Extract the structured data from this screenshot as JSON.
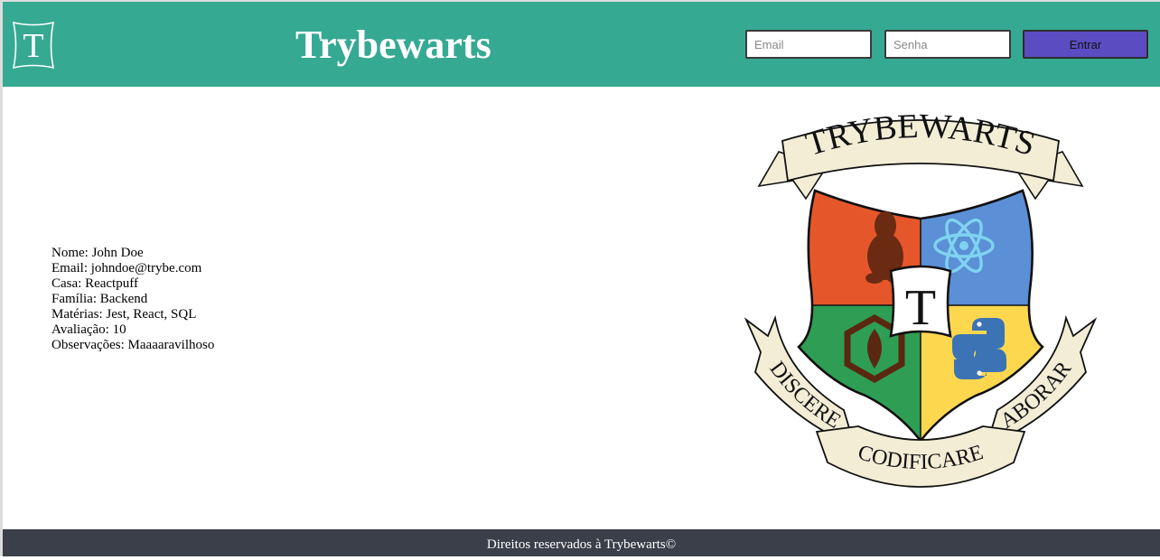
{
  "header": {
    "logo_letter": "T",
    "title": "Trybewarts",
    "email_placeholder": "Email",
    "password_placeholder": "Senha",
    "login_label": "Entrar"
  },
  "form_data": {
    "lines": [
      "Nome: John Doe",
      "Email: johndoe@trybe.com",
      "Casa: Reactpuff",
      "Família: Backend",
      "Matérias: Jest, React, SQL",
      "Avaliação: 10",
      "Observações: Maaaaravilhoso"
    ]
  },
  "crest": {
    "banner_text": "TRYBEWARTS",
    "center_letter": "T",
    "motto_left": "DISCERE",
    "motto_center": "CODIFICARE",
    "motto_right": "LABORARE",
    "colors": {
      "red": "#e5572a",
      "blue": "#5b8fd6",
      "green": "#2e9e55",
      "yellow": "#fdd84f",
      "ribbon": "#f3edd6"
    }
  },
  "footer": {
    "text": "Direitos reservados à Trybewarts©"
  },
  "colors": {
    "header_bg": "#36a993",
    "footer_bg": "#3b3f49",
    "button_bg": "#5b4cc2"
  }
}
